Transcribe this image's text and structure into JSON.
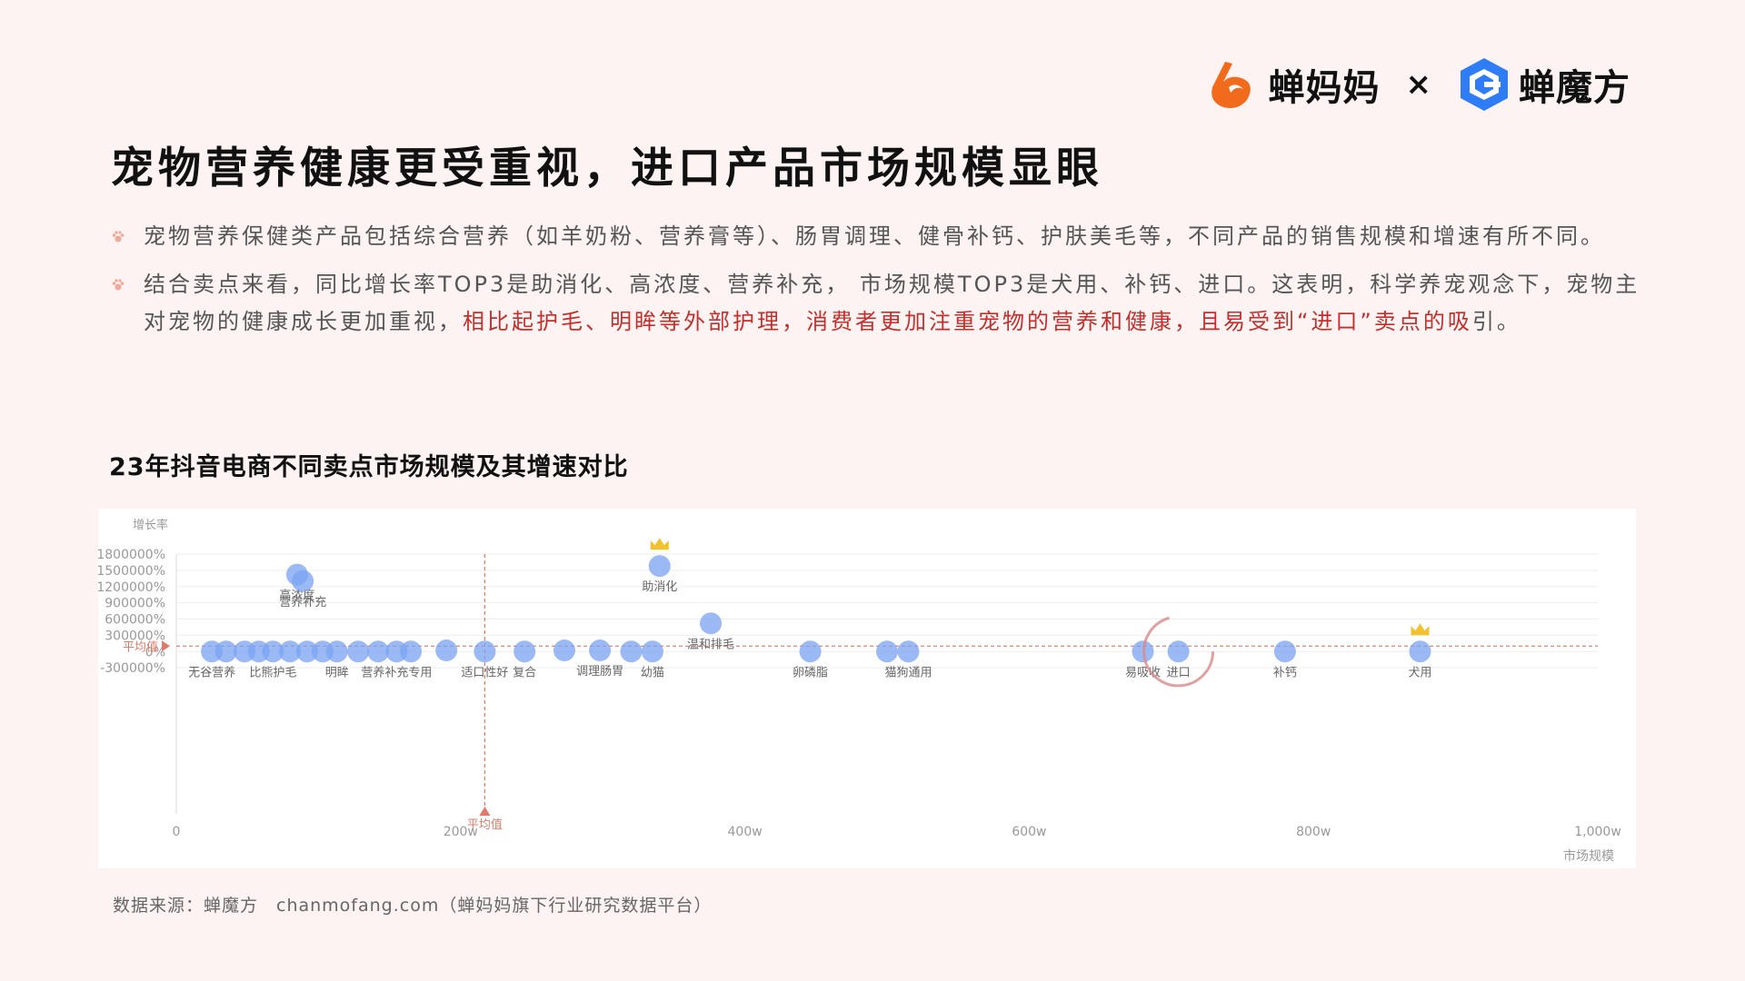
{
  "brand": {
    "logo1": "蝉妈妈",
    "times": "×",
    "logo2": "蝉魔方"
  },
  "title": "宠物营养健康更受重视，进口产品市场规模显眼",
  "bullets": [
    {
      "text": "宠物营养保健类产品包括综合营养（如羊奶粉、营养膏等）、肠胃调理、健骨补钙、护肤美毛等，不同产品的销售规模和增速有所不同。"
    },
    {
      "text_before": "结合卖点来看，同比增长率TOP3是助消化、高浓度、营养补充， 市场规模TOP3是犬用、补钙、进口。这表明，科学养宠观念下，宠物主对宠物的健康成长更加重视，",
      "text_highlight": "相比起护毛、明眸等外部护理，消费者更加注重宠物的营养和健康，且易受到“进口”卖点的吸",
      "text_after": "引。"
    }
  ],
  "chart_title": "23年抖音电商不同卖点市场规模及其增速对比",
  "source": "数据来源：蝉魔方　chanmofang.com（蝉妈妈旗下行业研究数据平台）",
  "colors": {
    "bubble": "#7aa3f2",
    "avg_line": "#e07a6a",
    "grid": "#eeeeee",
    "highlight_text": "#c2302e",
    "logo_orange": "#f26a1b",
    "logo_blue": "#2e7cf6"
  },
  "chart_data": {
    "type": "scatter",
    "xlabel": "市场规模",
    "ylabel": "增长率",
    "xlim": [
      0,
      1000
    ],
    "ylim": [
      -3000000,
      1800000
    ],
    "x_ticks": [
      "0",
      "200w",
      "400w",
      "600w",
      "800w",
      "1,000w"
    ],
    "x_tick_values": [
      0,
      200,
      400,
      600,
      800,
      1000
    ],
    "y_ticks": [
      "1800000%",
      "1500000%",
      "1200000%",
      "900000%",
      "600000%",
      "300000%",
      "0%",
      "-300000%"
    ],
    "y_tick_values": [
      1800000,
      1500000,
      1200000,
      900000,
      600000,
      300000,
      0,
      -300000
    ],
    "avg_x": 217,
    "avg_y": 100000,
    "avg_label": "平均值",
    "points": [
      {
        "x": 85,
        "y": 1420000,
        "label": "高浓度"
      },
      {
        "x": 89,
        "y": 1300000,
        "label": "营养补充"
      },
      {
        "x": 340,
        "y": 1580000,
        "label": "助消化",
        "crown": true
      },
      {
        "x": 376,
        "y": 520000,
        "label": "温和排毛"
      },
      {
        "x": 25,
        "y": 0,
        "label": "无谷营养"
      },
      {
        "x": 35,
        "y": 0,
        "label": ""
      },
      {
        "x": 48,
        "y": 0,
        "label": ""
      },
      {
        "x": 58,
        "y": 0,
        "label": ""
      },
      {
        "x": 68,
        "y": 0,
        "label": "比熊护毛"
      },
      {
        "x": 80,
        "y": 0,
        "label": ""
      },
      {
        "x": 92,
        "y": 0,
        "label": ""
      },
      {
        "x": 103,
        "y": 0,
        "label": ""
      },
      {
        "x": 113,
        "y": 0,
        "label": "明眸"
      },
      {
        "x": 128,
        "y": 0,
        "label": ""
      },
      {
        "x": 142,
        "y": 0,
        "label": ""
      },
      {
        "x": 155,
        "y": 0,
        "label": "营养补充专用"
      },
      {
        "x": 165,
        "y": 0,
        "label": ""
      },
      {
        "x": 190,
        "y": 20000,
        "label": ""
      },
      {
        "x": 217,
        "y": 0,
        "label": "适口性好"
      },
      {
        "x": 245,
        "y": 0,
        "label": "复合"
      },
      {
        "x": 273,
        "y": 20000,
        "label": ""
      },
      {
        "x": 298,
        "y": 20000,
        "label": "调理肠胃"
      },
      {
        "x": 320,
        "y": 0,
        "label": ""
      },
      {
        "x": 335,
        "y": 0,
        "label": "幼猫"
      },
      {
        "x": 446,
        "y": 0,
        "label": "卵磷脂"
      },
      {
        "x": 500,
        "y": 0,
        "label": ""
      },
      {
        "x": 515,
        "y": 0,
        "label": "猫狗通用"
      },
      {
        "x": 680,
        "y": 0,
        "label": "易吸收"
      },
      {
        "x": 705,
        "y": 0,
        "label": "进口",
        "ring": true
      },
      {
        "x": 780,
        "y": 0,
        "label": "补钙"
      },
      {
        "x": 875,
        "y": 0,
        "label": "犬用",
        "crown": true
      }
    ]
  }
}
